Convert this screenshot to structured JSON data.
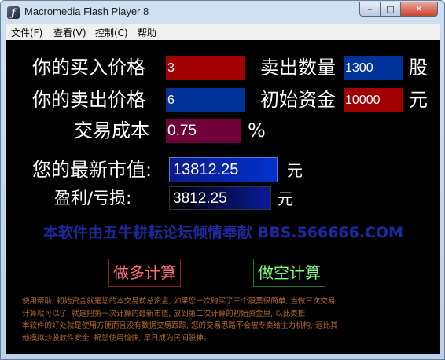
{
  "window": {
    "title": "Macromedia Flash Player 8",
    "min_label": "–",
    "max_label": "□",
    "close_label": "✕"
  },
  "menu": [
    "文件(F)",
    "查看(V)",
    "控制(C)",
    "帮助"
  ],
  "labels": {
    "buy_price": "你的买入价格",
    "sell_price": "你的卖出价格",
    "cost": "交易成本",
    "sell_qty": "卖出数量",
    "capital": "初始资金",
    "shares_unit": "股",
    "yuan_unit": "元",
    "percent_unit": "%",
    "market_value": "您的最新市值:",
    "profit_loss": "盈利/亏损:",
    "mv_unit": "元",
    "pl_unit": "元"
  },
  "fields": {
    "buy_price": "3",
    "sell_price": "6",
    "cost": "0.75",
    "sell_qty": "1300",
    "capital": "10000",
    "market_value": "13812.25",
    "profit_loss": "3812.25"
  },
  "watermark": "本软件由五牛耕耘论坛倾情奉献  BBS.566666.COM",
  "buttons": {
    "long": "做多计算",
    "short": "做空计算"
  },
  "help_lines": [
    "使用帮助: 初始资金就是您的本交易前总资金, 如果您一次购买了三个股票很简单, 当做三次交易",
    "计算就可以了, 就是把第一次计算的最新市值, 放到第二次计算的初始资金里, 以此类推",
    "本软件的好处就是使用方便而且没有数据交易跟踪, 您的交易思路不会被专卖给主力机构, 远比其",
    "他模拟炒股软件安全, 祝您使用愉快, 早日成为民间股神。"
  ],
  "colors": {
    "red_field": "#a00000",
    "blue_field": "#003399",
    "maroon_field": "#70003a",
    "stage_bg": "#000000"
  }
}
